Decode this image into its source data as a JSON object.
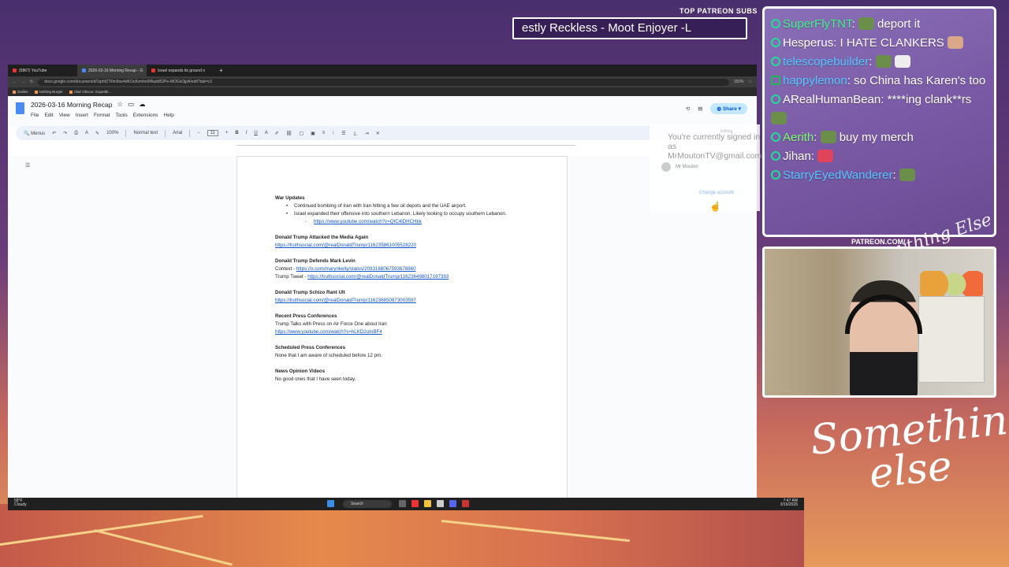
{
  "overlay": {
    "sub_title": "TOP PATREON SUBS",
    "sub_banner": "estly Reckless - Moot Enjoyer -L",
    "patreon_label": "PATREON.COM/",
    "script_small": "Anything Else",
    "script_large_1": "Something",
    "script_large_2": "else"
  },
  "chat": {
    "messages": [
      {
        "user": "SuperFlyTNT",
        "text": " deport it"
      },
      {
        "user": "Hesperus",
        "text": " I HATE CLANKERS"
      },
      {
        "user": "telescopebuilder",
        "text": ""
      },
      {
        "user": "happylemon",
        "text": " so China has Karen's too"
      },
      {
        "user": "ARealHumanBean",
        "text": " ****ing clank**rs"
      },
      {
        "user": "Aerith",
        "text": " buy my merch"
      },
      {
        "user": "Jihan",
        "text": ""
      },
      {
        "user": "StarryEyedWanderer",
        "text": ""
      }
    ]
  },
  "browser": {
    "tabs": [
      {
        "label": "(5867) YouTube"
      },
      {
        "label": "2026-03-16 Morning Recap - G"
      },
      {
        "label": "Israel expands its ground o"
      }
    ],
    "url": "docs.google.com/document/d/1tphfZTiIlm9oe4dKOu5vmhn0fAadd52Pe-MOGsOjpA/edit?tab=t.0",
    "zoom": "150%",
    "bookmarks": [
      "Dailies",
      "Nothing Burger",
      "Clair Obscur: Expediti..."
    ]
  },
  "doc": {
    "title": "2026-03-16 Morning Recap",
    "menus": [
      "File",
      "Edit",
      "View",
      "Insert",
      "Format",
      "Tools",
      "Extensions",
      "Help"
    ],
    "share_label": "Share",
    "toolbar": {
      "search": "Menus",
      "zoom": "100%",
      "style": "Normal text",
      "font": "Arial",
      "size": "11"
    },
    "sections": [
      {
        "heading": "War Updates"
      },
      {
        "heading": "Donald Trump Attacked the Media Again"
      },
      {
        "heading": "Donald Trump Defends Mark Levin"
      },
      {
        "heading": "Donald Trump Schizo Rant Ult"
      },
      {
        "heading": "Recent Press Conferences"
      },
      {
        "heading": "Scheduled Press Conferences"
      },
      {
        "heading": "News Opinion Videos"
      }
    ],
    "war_b1": "Continued bombing of Iran with Iran hitting a few oil depots and the UAE airport.",
    "war_b2": "Israel expanded their offensive into southern Lebanon. Likely looking to occupy southern Lebanon.",
    "war_link": "https://www.youtube.com/watch?v=QtC4lDHCHkk",
    "media_link": "https://truthsocial.com/@realDonaldTrump/116235861005528220",
    "levin_context_label": "Context - ",
    "levin_context_link": "https://x.com/marynkelly/status/2033168067593678860",
    "levin_tweet_label": "Trump Tweet - ",
    "levin_tweet_link": "https://truthsocial.com/@realDonaldTrump/116236498017197393",
    "schizo_link": "https://truthsocial.com/@realDonaldTrump/116236850873003597",
    "press_text": "Trump Talks with Press on Air Force One about Iran",
    "press_link": "https://www.youtube.com/watch?v=hLKD2uInBF4",
    "scheduled_text": "None that I am aware of scheduled before 12 pm.",
    "opinion_text": "No good ones that I have seen today."
  },
  "account": {
    "editing": "Editing",
    "message": "You're currently signed in as MrMoutonTV@gmail.com",
    "user": "Mr Mouton",
    "change": "Change account"
  },
  "taskbar": {
    "temp": "58°F",
    "weather": "Cloudy",
    "search": "Search",
    "time": "7:47 AM",
    "date": "3/16/2026"
  }
}
